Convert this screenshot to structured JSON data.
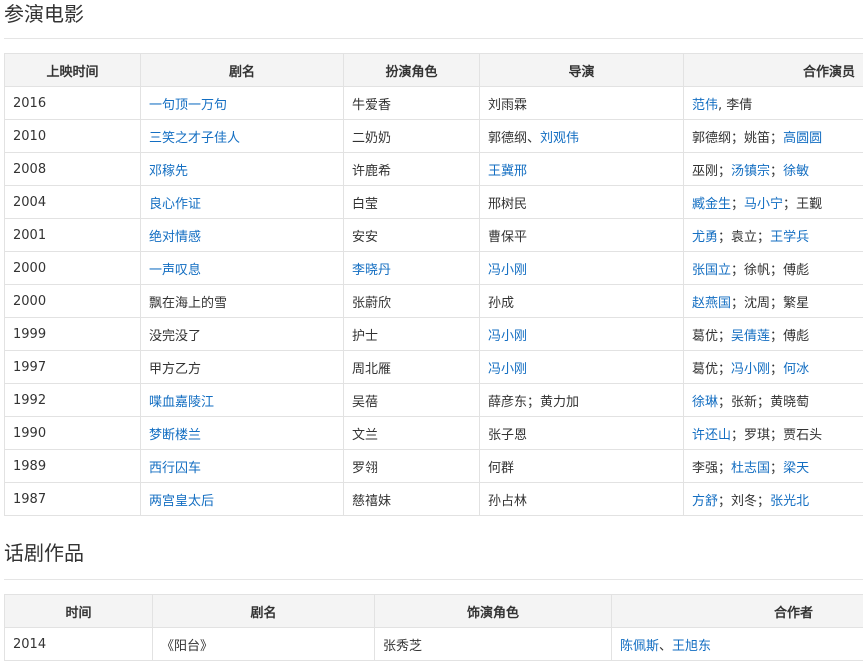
{
  "films_section": {
    "title": "参演电影",
    "headers": [
      "上映时间",
      "剧名",
      "扮演角色",
      "导演",
      "合作演员"
    ],
    "rows": [
      {
        "year": "2016",
        "title": [
          {
            "t": "一句顶一万句",
            "link": true
          }
        ],
        "role": "牛爱香",
        "director": [
          {
            "t": "刘雨霖",
            "link": false
          }
        ],
        "costars": [
          {
            "t": "范伟",
            "link": true
          },
          {
            "t": ", ",
            "link": false
          },
          {
            "t": "李倩",
            "link": false
          }
        ]
      },
      {
        "year": "2010",
        "title": [
          {
            "t": "三笑之才子佳人",
            "link": true
          }
        ],
        "role": "二奶奶",
        "director": [
          {
            "t": "郭德纲",
            "link": false
          },
          {
            "t": "、",
            "link": false
          },
          {
            "t": "刘观伟",
            "link": true
          }
        ],
        "costars": [
          {
            "t": "郭德纲",
            "link": false
          },
          {
            "t": "；",
            "link": false
          },
          {
            "t": "姚笛",
            "link": false
          },
          {
            "t": "；",
            "link": false
          },
          {
            "t": "高圆圆",
            "link": true
          }
        ]
      },
      {
        "year": "2008",
        "title": [
          {
            "t": "邓稼先",
            "link": true
          }
        ],
        "role": "许鹿希",
        "director": [
          {
            "t": "王冀邢",
            "link": true
          }
        ],
        "costars": [
          {
            "t": "巫刚",
            "link": false
          },
          {
            "t": "；",
            "link": false
          },
          {
            "t": "汤镇宗",
            "link": true
          },
          {
            "t": "；",
            "link": false
          },
          {
            "t": "徐敏",
            "link": true
          }
        ]
      },
      {
        "year": "2004",
        "title": [
          {
            "t": "良心作证",
            "link": true
          }
        ],
        "role": "白莹",
        "director": [
          {
            "t": "邢树民",
            "link": false
          }
        ],
        "costars": [
          {
            "t": "臧金生",
            "link": true
          },
          {
            "t": "；",
            "link": false
          },
          {
            "t": "马小宁",
            "link": true
          },
          {
            "t": "；",
            "link": false
          },
          {
            "t": "王觐",
            "link": false
          }
        ]
      },
      {
        "year": "2001",
        "title": [
          {
            "t": "绝对情感",
            "link": true
          }
        ],
        "role": "安安",
        "director": [
          {
            "t": "曹保平",
            "link": false
          }
        ],
        "costars": [
          {
            "t": "尤勇",
            "link": true
          },
          {
            "t": "；",
            "link": false
          },
          {
            "t": "袁立",
            "link": false
          },
          {
            "t": "；",
            "link": false
          },
          {
            "t": "王学兵",
            "link": true
          }
        ]
      },
      {
        "year": "2000",
        "title": [
          {
            "t": "一声叹息",
            "link": true
          }
        ],
        "role": [
          {
            "t": "李晓丹",
            "link": true
          }
        ],
        "director": [
          {
            "t": "冯小刚",
            "link": true
          }
        ],
        "costars": [
          {
            "t": "张国立",
            "link": true
          },
          {
            "t": "；",
            "link": false
          },
          {
            "t": "徐帆",
            "link": false
          },
          {
            "t": "；",
            "link": false
          },
          {
            "t": "傅彪",
            "link": false
          }
        ]
      },
      {
        "year": "2000",
        "title": [
          {
            "t": "飘在海上的雪",
            "link": false
          }
        ],
        "role": "张蔚欣",
        "director": [
          {
            "t": "孙成",
            "link": false
          }
        ],
        "costars": [
          {
            "t": "赵燕国",
            "link": true
          },
          {
            "t": "；",
            "link": false
          },
          {
            "t": "沈周",
            "link": false
          },
          {
            "t": "；",
            "link": false
          },
          {
            "t": "繁星",
            "link": false
          }
        ]
      },
      {
        "year": "1999",
        "title": [
          {
            "t": "没完没了",
            "link": false
          }
        ],
        "role": "护士",
        "director": [
          {
            "t": "冯小刚",
            "link": true
          }
        ],
        "costars": [
          {
            "t": "葛优",
            "link": false
          },
          {
            "t": "；",
            "link": false
          },
          {
            "t": "吴倩莲",
            "link": true
          },
          {
            "t": "；",
            "link": false
          },
          {
            "t": "傅彪",
            "link": false
          }
        ]
      },
      {
        "year": "1997",
        "title": [
          {
            "t": "甲方乙方",
            "link": false
          }
        ],
        "role": "周北雁",
        "director": [
          {
            "t": "冯小刚",
            "link": true
          }
        ],
        "costars": [
          {
            "t": "葛优",
            "link": false
          },
          {
            "t": "；",
            "link": false
          },
          {
            "t": "冯小刚",
            "link": true
          },
          {
            "t": "；",
            "link": false
          },
          {
            "t": "何冰",
            "link": true
          }
        ]
      },
      {
        "year": "1992",
        "title": [
          {
            "t": "喋血嘉陵江",
            "link": true
          }
        ],
        "role": "吴蓓",
        "director": [
          {
            "t": "薛彦东",
            "link": false
          },
          {
            "t": "；",
            "link": false
          },
          {
            "t": "黄力加",
            "link": false
          }
        ],
        "costars": [
          {
            "t": "徐琳",
            "link": true
          },
          {
            "t": "；",
            "link": false
          },
          {
            "t": "张新",
            "link": false
          },
          {
            "t": "；",
            "link": false
          },
          {
            "t": "黄晓萄",
            "link": false
          }
        ]
      },
      {
        "year": "1990",
        "title": [
          {
            "t": "梦断楼兰",
            "link": true
          }
        ],
        "role": "文兰",
        "director": [
          {
            "t": "张子恩",
            "link": false
          }
        ],
        "costars": [
          {
            "t": "许还山",
            "link": true
          },
          {
            "t": "；",
            "link": false
          },
          {
            "t": "罗琪",
            "link": false
          },
          {
            "t": "；",
            "link": false
          },
          {
            "t": "贾石头",
            "link": false
          }
        ]
      },
      {
        "year": "1989",
        "title": [
          {
            "t": "西行囚车",
            "link": true
          }
        ],
        "role": "罗翎",
        "director": [
          {
            "t": "何群",
            "link": false
          }
        ],
        "costars": [
          {
            "t": "李强",
            "link": false
          },
          {
            "t": "；",
            "link": false
          },
          {
            "t": "杜志国",
            "link": true
          },
          {
            "t": "；",
            "link": false
          },
          {
            "t": "梁天",
            "link": true
          }
        ]
      },
      {
        "year": "1987",
        "title": [
          {
            "t": "两宫皇太后",
            "link": true
          }
        ],
        "role": "慈禧妹",
        "director": [
          {
            "t": "孙占林",
            "link": false
          }
        ],
        "costars": [
          {
            "t": "方舒",
            "link": true
          },
          {
            "t": "；",
            "link": false
          },
          {
            "t": "刘冬",
            "link": false
          },
          {
            "t": "；",
            "link": false
          },
          {
            "t": "张光北",
            "link": true
          }
        ]
      }
    ]
  },
  "plays_section": {
    "title": "话剧作品",
    "headers": [
      "时间",
      "剧名",
      "饰演角色",
      "合作者"
    ],
    "rows": [
      {
        "year": "2014",
        "title": [
          {
            "t": "《阳台》",
            "link": false
          }
        ],
        "role": "张秀芝",
        "partners": [
          {
            "t": "陈佩斯",
            "link": true
          },
          {
            "t": "、",
            "link": false
          },
          {
            "t": "王旭东",
            "link": true
          }
        ]
      }
    ]
  },
  "colors": {
    "link": "#136ec2",
    "text": "#333333",
    "header_bg": "#f4f4f4",
    "border": "#e2e2e2"
  }
}
